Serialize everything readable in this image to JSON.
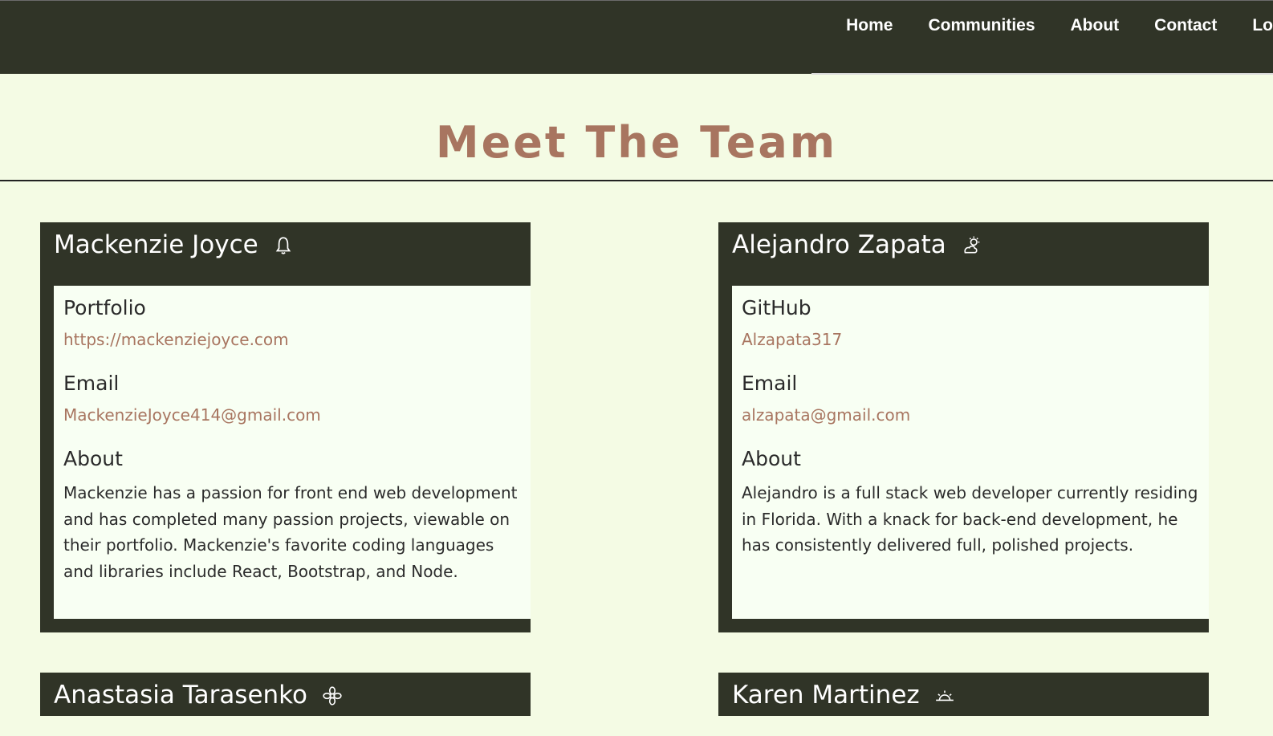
{
  "nav": {
    "items": [
      {
        "label": "Home"
      },
      {
        "label": "Communities"
      },
      {
        "label": "About"
      },
      {
        "label": "Contact"
      },
      {
        "label": "Lo"
      }
    ]
  },
  "page": {
    "title": "Meet The Team"
  },
  "team": [
    {
      "name": "Mackenzie Joyce",
      "icon": "bell-icon",
      "link_label": "Portfolio",
      "link_value": "https://mackenziejoyce.com",
      "email_label": "Email",
      "email_value": "MackenzieJoyce414@gmail.com",
      "about_label": "About",
      "about_text": "Mackenzie has a passion for front end web development and has completed many passion projects, viewable on their portfolio. Mackenzie's favorite coding languages and libraries include React, Bootstrap, and Node."
    },
    {
      "name": "Alejandro Zapata",
      "icon": "cloud-sun-icon",
      "link_label": "GitHub",
      "link_value": "Alzapata317",
      "email_label": "Email",
      "email_value": "alzapata@gmail.com",
      "about_label": "About",
      "about_text": "Alejandro is a full stack web developer currently residing in Florida. With a knack for back-end development, he has consistently delivered full, polished projects."
    },
    {
      "name": "Anastasia Tarasenko",
      "icon": "flower-icon"
    },
    {
      "name": "Karen Martinez",
      "icon": "sunrise-icon"
    }
  ],
  "colors": {
    "background": "#f4fbe4",
    "dark": "#303427",
    "accent": "#a87560",
    "card_body": "#f8fff3"
  }
}
